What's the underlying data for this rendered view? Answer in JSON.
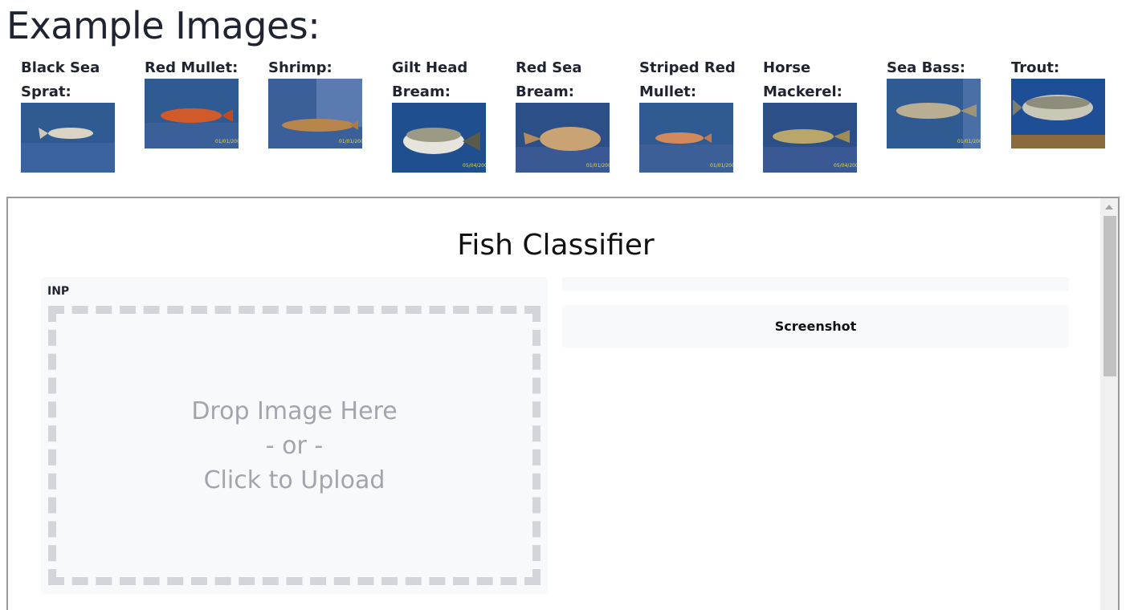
{
  "heading": "Example Images:",
  "examples": [
    {
      "label": "Black Sea Sprat:",
      "icon": "black-sea-sprat-photo"
    },
    {
      "label": "Red Mullet:",
      "icon": "red-mullet-photo"
    },
    {
      "label": "Shrimp:",
      "icon": "shrimp-photo"
    },
    {
      "label": "Gilt Head Bream:",
      "icon": "gilt-head-bream-photo"
    },
    {
      "label": "Red Sea Bream:",
      "icon": "red-sea-bream-photo"
    },
    {
      "label": "Striped Red Mullet:",
      "icon": "striped-red-mullet-photo"
    },
    {
      "label": "Horse Mackerel:",
      "icon": "horse-mackerel-photo"
    },
    {
      "label": "Sea Bass:",
      "icon": "sea-bass-photo"
    },
    {
      "label": "Trout:",
      "icon": "trout-photo"
    }
  ],
  "app": {
    "title": "Fish Classifier",
    "input_label": "INP",
    "dropzone": {
      "line1": "Drop Image Here",
      "line2": "- or -",
      "line3": "Click to Upload"
    },
    "screenshot_label": "Screenshot"
  },
  "colors": {
    "panel_bg": "#f8f9fa",
    "dash": "#d3d5da",
    "placeholder_text": "#a1a5ad",
    "photo_background": "#2b4f86"
  }
}
